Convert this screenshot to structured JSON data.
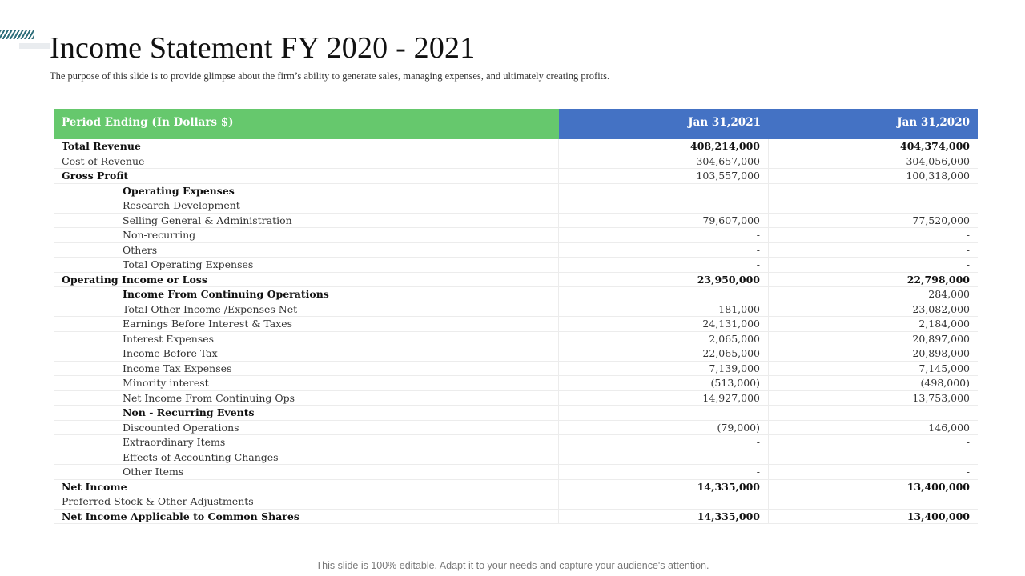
{
  "slide": {
    "title": "Income Statement FY 2020 - 2021",
    "subtitle": "The purpose of this slide is to provide glimpse about the firm’s ability to generate  sales, managing  expenses,  and ultimately  creating  profits.",
    "footer": "This slide is 100% editable. Adapt it to your needs and capture your audience's attention."
  },
  "colors": {
    "header_green": "#66c86d",
    "header_blue": "#4472c4"
  },
  "table": {
    "headers": {
      "period": "Period Ending (In Dollars $)",
      "col1": "Jan 31,2021",
      "col2": "Jan 31,2020"
    },
    "arrows": "»»»",
    "rows": [
      {
        "label": "Total Revenue",
        "v2021": "408,214,000",
        "v2020": "404,374,000",
        "bold": true,
        "indent": false
      },
      {
        "label": "Cost of Revenue",
        "v2021": "304,657,000",
        "v2020": "304,056,000",
        "bold": false,
        "indent": false
      },
      {
        "label": "Gross Profit",
        "v2021": "103,557,000",
        "v2020": "100,318,000",
        "bold": "label",
        "indent": false
      },
      {
        "label": "Operating Expenses",
        "v2021": "",
        "v2020": "",
        "bold": true,
        "indent": true
      },
      {
        "label": "Research Development",
        "v2021": "-",
        "v2020": "-",
        "bold": false,
        "indent": true
      },
      {
        "label": "Selling General & Administration",
        "v2021": "79,607,000",
        "v2020": "77,520,000",
        "bold": false,
        "indent": true
      },
      {
        "label": "Non-recurring",
        "v2021": "-",
        "v2020": "-",
        "bold": false,
        "indent": true
      },
      {
        "label": "Others",
        "v2021": "-",
        "v2020": "-",
        "bold": false,
        "indent": true
      },
      {
        "label": "Total Operating Expenses",
        "v2021": "-",
        "v2020": "-",
        "bold": false,
        "indent": true
      },
      {
        "label": "Operating Income or Loss",
        "v2021": "23,950,000",
        "v2020": "22,798,000",
        "bold": true,
        "indent": false
      },
      {
        "label": "Income From Continuing Operations",
        "v2021": "",
        "v2020": "284,000",
        "bold": "label",
        "indent": true
      },
      {
        "label": "Total Other Income /Expenses Net",
        "v2021": "181,000",
        "v2020": "23,082,000",
        "bold": false,
        "indent": true
      },
      {
        "label": "Earnings Before Interest & Taxes",
        "v2021": "24,131,000",
        "v2020": "2,184,000",
        "bold": false,
        "indent": true
      },
      {
        "label": "Interest Expenses",
        "v2021": "2,065,000",
        "v2020": "20,897,000",
        "bold": false,
        "indent": true
      },
      {
        "label": "Income Before Tax",
        "v2021": "22,065,000",
        "v2020": "20,898,000",
        "bold": false,
        "indent": true
      },
      {
        "label": "Income Tax Expenses",
        "v2021": "7,139,000",
        "v2020": "7,145,000",
        "bold": false,
        "indent": true
      },
      {
        "label": "Minority interest",
        "v2021": "(513,000)",
        "v2020": "(498,000)",
        "bold": false,
        "indent": true
      },
      {
        "label": "Net Income From Continuing Ops",
        "v2021": "14,927,000",
        "v2020": "13,753,000",
        "bold": false,
        "indent": true
      },
      {
        "label": "Non - Recurring Events",
        "v2021": "",
        "v2020": "",
        "bold": true,
        "indent": true
      },
      {
        "label": "Discounted Operations",
        "v2021": "(79,000)",
        "v2020": "146,000",
        "bold": false,
        "indent": true
      },
      {
        "label": "Extraordinary Items",
        "v2021": "-",
        "v2020": "-",
        "bold": false,
        "indent": true
      },
      {
        "label": "Effects of Accounting Changes",
        "v2021": "-",
        "v2020": "-",
        "bold": false,
        "indent": true
      },
      {
        "label": "Other Items",
        "v2021": "-",
        "v2020": "-",
        "bold": false,
        "indent": true
      },
      {
        "label": "Net Income",
        "v2021": "14,335,000",
        "v2020": "13,400,000",
        "bold": true,
        "indent": false
      },
      {
        "label": "Preferred Stock & Other Adjustments",
        "v2021": "-",
        "v2020": "-",
        "bold": false,
        "indent": false
      },
      {
        "label": "Net Income Applicable to Common Shares",
        "v2021": "14,335,000",
        "v2020": "13,400,000",
        "bold": true,
        "indent": false
      }
    ]
  }
}
